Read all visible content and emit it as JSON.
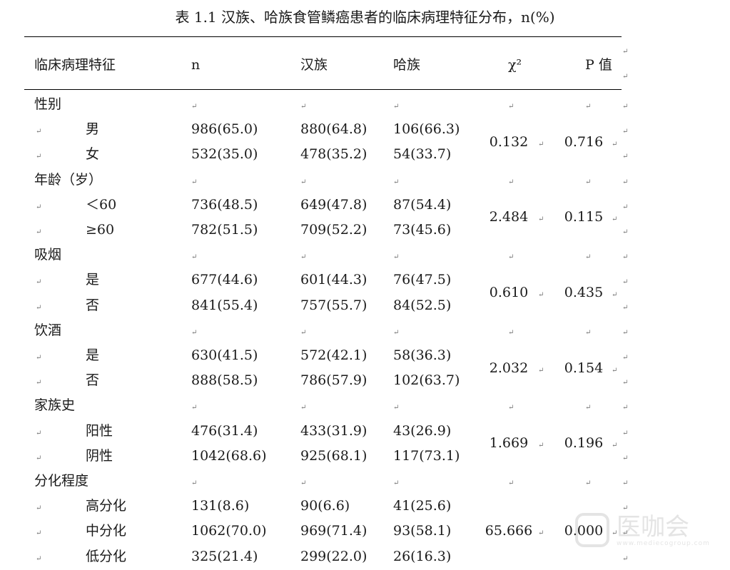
{
  "caption": "表 1.1  汉族、哈族食管鳞癌患者的临床病理特征分布，n(%)",
  "paragraph_mark": "↵",
  "chart_data": {
    "type": "table",
    "columns": [
      "临床病理特征",
      "n",
      "汉族",
      "哈族",
      "χ²",
      "P 值"
    ],
    "groups": [
      {
        "name": "性别",
        "chi2": "0.132",
        "p": "0.716",
        "rows": [
          {
            "label": "男",
            "n": "986(65.0)",
            "han": "880(64.8)",
            "kazakh": "106(66.3)"
          },
          {
            "label": "女",
            "n": "532(35.0)",
            "han": "478(35.2)",
            "kazakh": "54(33.7)"
          }
        ]
      },
      {
        "name": "年龄（岁）",
        "chi2": "2.484",
        "p": "0.115",
        "rows": [
          {
            "label": "＜60",
            "n": "736(48.5)",
            "han": "649(47.8)",
            "kazakh": "87(54.4)"
          },
          {
            "label": "≥60",
            "n": "782(51.5)",
            "han": "709(52.2)",
            "kazakh": "73(45.6)"
          }
        ]
      },
      {
        "name": "吸烟",
        "chi2": "0.610",
        "p": "0.435",
        "rows": [
          {
            "label": "是",
            "n": "677(44.6)",
            "han": "601(44.3)",
            "kazakh": "76(47.5)"
          },
          {
            "label": "否",
            "n": "841(55.4)",
            "han": "757(55.7)",
            "kazakh": "84(52.5)"
          }
        ]
      },
      {
        "name": "饮酒",
        "chi2": "2.032",
        "p": "0.154",
        "rows": [
          {
            "label": "是",
            "n": "630(41.5)",
            "han": "572(42.1)",
            "kazakh": "58(36.3)"
          },
          {
            "label": "否",
            "n": "888(58.5)",
            "han": "786(57.9)",
            "kazakh": "102(63.7)"
          }
        ]
      },
      {
        "name": "家族史",
        "chi2": "1.669",
        "p": "0.196",
        "rows": [
          {
            "label": "阳性",
            "n": "476(31.4)",
            "han": "433(31.9)",
            "kazakh": "43(26.9)"
          },
          {
            "label": "阴性",
            "n": "1042(68.6)",
            "han": "925(68.1)",
            "kazakh": "117(73.1)"
          }
        ]
      },
      {
        "name": "分化程度",
        "chi2": "65.666",
        "p": "0.000",
        "rows": [
          {
            "label": "高分化",
            "n": "131(8.6)",
            "han": "90(6.6)",
            "kazakh": "41(25.6)"
          },
          {
            "label": "中分化",
            "n": "1062(70.0)",
            "han": "969(71.4)",
            "kazakh": "93(58.1)"
          },
          {
            "label": "低分化",
            "n": "325(21.4)",
            "han": "299(22.0)",
            "kazakh": "26(16.3)"
          }
        ]
      }
    ]
  },
  "watermark": {
    "text": "医咖会",
    "sub": "www.mediecogroup.com"
  }
}
